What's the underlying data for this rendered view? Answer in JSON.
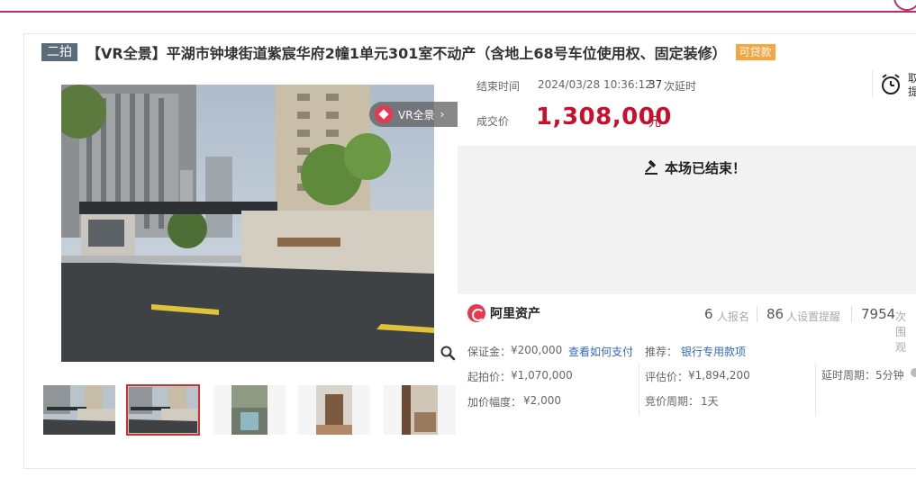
{
  "header": {
    "tag": "二拍",
    "title": "【VR全景】平湖市钟埭街道紫宸华府2幢1单元301室不动产（含地上68号车位使用权、固定装修）",
    "loan_tag": "可贷款"
  },
  "gallery": {
    "vr_label": "VR全景",
    "vr_chevron": "›",
    "zoom_icon": "magnifier-icon",
    "thumbnail_count": 5,
    "active_thumbnail": 2
  },
  "auction": {
    "end_label": "结束时间",
    "end_time": "2024/03/28 10:36:12",
    "delay_count": "37",
    "delay_label": "次延时",
    "clock_icon": "alarm-clock-icon",
    "clock_side_1": "取",
    "clock_side_2": "提",
    "deal_label": "成交价",
    "deal_price": "1,308,000",
    "deal_unit": "元",
    "ended_text": "本场已结束！",
    "ended_icon": "gavel-icon"
  },
  "platform": {
    "name": "阿里资产",
    "icon": "ali-asset-logo-icon"
  },
  "stats": [
    {
      "num": "6",
      "label": "人报名"
    },
    {
      "num": "86",
      "label": "人设置提醒"
    },
    {
      "num": "7954",
      "label": "次围观"
    }
  ],
  "details": {
    "deposit_label": "保证金：",
    "deposit_value": "¥200,000",
    "pay_link": "查看如何支付",
    "recommend_label": "推荐：",
    "recommend_link": "银行专用款项",
    "start_price_label": "起拍价：",
    "start_price_value": "¥1,070,000",
    "eval_label": "评估价：",
    "eval_value": "¥1,894,200",
    "delay_period_label": "延时周期：",
    "delay_period_value": "5分钟",
    "increment_label": "加价幅度：",
    "increment_value": "¥2,000",
    "bid_period_label": "竞价周期：",
    "bid_period_value": "1天"
  },
  "colors": {
    "accent_line": "#b3306a",
    "price_red": "#c8102e",
    "loan_orange": "#f7a541",
    "link_blue": "#3366cc"
  }
}
